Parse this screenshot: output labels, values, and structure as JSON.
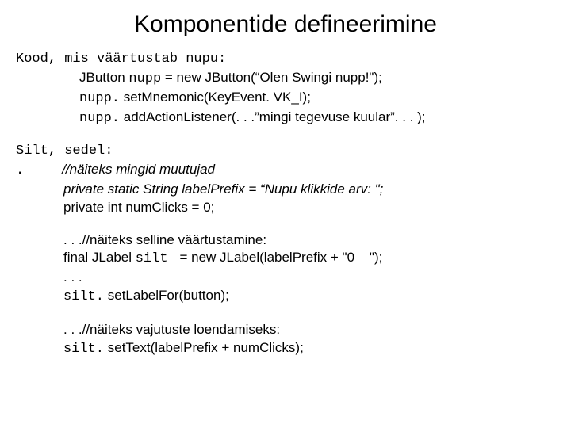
{
  "title": "Komponentide defineerimine",
  "section1": {
    "lead_mono": "Kood, mis väärtustab nupu:",
    "l1a": "JButton ",
    "l1b": "nupp",
    "l1c": " = new JButton(“Olen Swingi nupp!\");",
    "l2a": "nupp.",
    "l2b": " setMnemonic(KeyEvent. VK_I);",
    "l3a": "nupp.",
    "l3b": " addActionListener(. . .”mingi tegevuse kuular”. . . );"
  },
  "section2": {
    "lead_mono": "Silt, sedel:",
    "dot": ".",
    "comment1": "//näiteks mingid muutujad",
    "l1": "private static String labelPrefix = “Nupu klikkide arv: \";",
    "l2": "private int numClicks = 0;"
  },
  "section3": {
    "comment": ". . .//näiteks selline väärtustamine:",
    "l1a": "final JLabel ",
    "l1b": "silt ",
    "l1c": " = new JLabel(labelPrefix + \"0    \");",
    "l2": ". . .",
    "l3a": "silt.",
    "l3b": " setLabelFor(button);"
  },
  "section4": {
    "comment": ". . .//näiteks vajutuste loendamiseks:",
    "l1a": "silt.",
    "l1b": " setText(labelPrefix + numClicks);"
  }
}
